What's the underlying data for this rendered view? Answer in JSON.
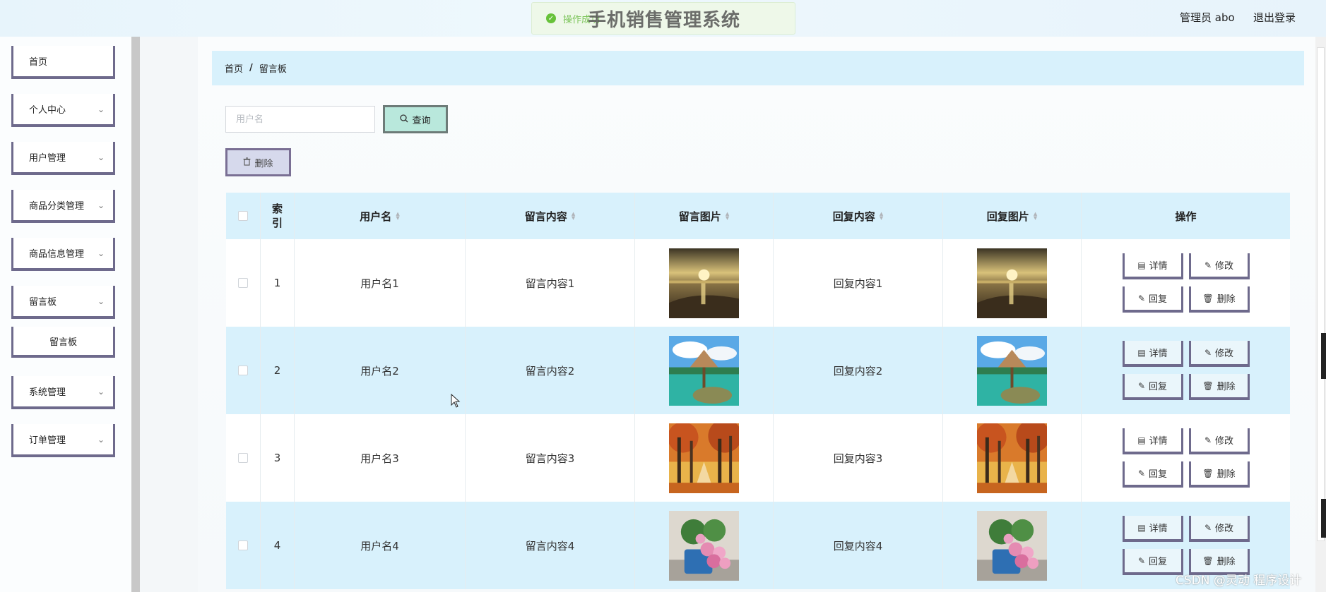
{
  "header": {
    "title": "手机销售管理系统",
    "toast": "操作成功",
    "user": "管理员 abo",
    "logout": "退出登录"
  },
  "sidebar": {
    "items": [
      {
        "label": "首页"
      },
      {
        "label": "个人中心"
      },
      {
        "label": "用户管理"
      },
      {
        "label": "商品分类管理"
      },
      {
        "label": "商品信息管理"
      },
      {
        "label": "留言板"
      },
      {
        "label": "留言板"
      },
      {
        "label": "系统管理"
      },
      {
        "label": "订单管理"
      }
    ]
  },
  "breadcrumb": {
    "home": "首页",
    "sep": "/",
    "current": "留言板"
  },
  "search": {
    "placeholder": "用户名",
    "button": "查询"
  },
  "toolbar": {
    "delete": "删除"
  },
  "table": {
    "headers": {
      "index": [
        "索",
        "引"
      ],
      "user": "用户名",
      "message": "留言内容",
      "image": "留言图片",
      "reply": "回复内容",
      "reply_image": "回复图片",
      "ops": "操作"
    },
    "op_labels": {
      "detail": "详情",
      "edit": "修改",
      "reply": "回复",
      "delete": "删除"
    },
    "rows": [
      {
        "index": "1",
        "user": "用户名1",
        "message": "留言内容1",
        "reply": "回复内容1",
        "image": "sunset-beach"
      },
      {
        "index": "2",
        "user": "用户名2",
        "message": "留言内容2",
        "reply": "回复内容2",
        "image": "tropical-lagoon"
      },
      {
        "index": "3",
        "user": "用户名3",
        "message": "留言内容3",
        "reply": "回复内容3",
        "image": "autumn-forest"
      },
      {
        "index": "4",
        "user": "用户名4",
        "message": "留言内容4",
        "reply": "回复内容4",
        "image": "flower-pot"
      }
    ]
  },
  "watermark": "CSDN @灵动 程序设计"
}
